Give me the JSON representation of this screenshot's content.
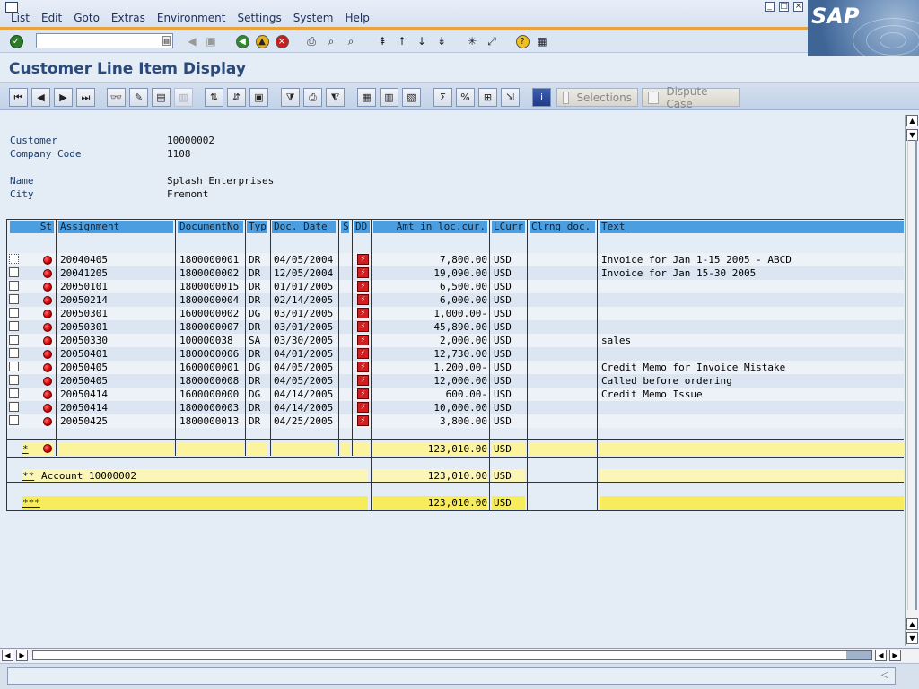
{
  "menubar": {
    "items": [
      "List",
      "Edit",
      "Goto",
      "Extras",
      "Environment",
      "Settings",
      "System",
      "Help"
    ],
    "logo": "SAP"
  },
  "systoolbar": {
    "command_value": ""
  },
  "title": "Customer Line Item Display",
  "apptoolbar": {
    "selections_label": "Selections",
    "dispute_label": "Dispute Case"
  },
  "header": {
    "customer_label": "Customer",
    "customer_value": "10000002",
    "company_code_label": "Company Code",
    "company_code_value": "1108",
    "name_label": "Name",
    "name_value": "Splash Enterprises",
    "city_label": "City",
    "city_value": "Fremont"
  },
  "grid": {
    "columns": [
      "St",
      "Assignment",
      "DocumentNo",
      "Typ",
      "Doc. Date",
      "S",
      "DD",
      "Amt in loc.cur.",
      "LCurr",
      "Clrng doc.",
      "Text"
    ],
    "rows": [
      {
        "assignment": "20040405",
        "docno": "1800000001",
        "typ": "DR",
        "date": "04/05/2004",
        "amount": "7,800.00",
        "curr": "USD",
        "text": "Invoice for Jan 1-15 2005 - ABCD"
      },
      {
        "assignment": "20041205",
        "docno": "1800000002",
        "typ": "DR",
        "date": "12/05/2004",
        "amount": "19,090.00",
        "curr": "USD",
        "text": "Invoice for Jan 15-30  2005"
      },
      {
        "assignment": "20050101",
        "docno": "1800000015",
        "typ": "DR",
        "date": "01/01/2005",
        "amount": "6,500.00",
        "curr": "USD",
        "text": ""
      },
      {
        "assignment": "20050214",
        "docno": "1800000004",
        "typ": "DR",
        "date": "02/14/2005",
        "amount": "6,000.00",
        "curr": "USD",
        "text": ""
      },
      {
        "assignment": "20050301",
        "docno": "1600000002",
        "typ": "DG",
        "date": "03/01/2005",
        "amount": "1,000.00-",
        "curr": "USD",
        "text": ""
      },
      {
        "assignment": "20050301",
        "docno": "1800000007",
        "typ": "DR",
        "date": "03/01/2005",
        "amount": "45,890.00",
        "curr": "USD",
        "text": ""
      },
      {
        "assignment": "20050330",
        "docno": "100000038",
        "typ": "SA",
        "date": "03/30/2005",
        "amount": "2,000.00",
        "curr": "USD",
        "text": "sales"
      },
      {
        "assignment": "20050401",
        "docno": "1800000006",
        "typ": "DR",
        "date": "04/01/2005",
        "amount": "12,730.00",
        "curr": "USD",
        "text": ""
      },
      {
        "assignment": "20050405",
        "docno": "1600000001",
        "typ": "DG",
        "date": "04/05/2005",
        "amount": "1,200.00-",
        "curr": "USD",
        "text": "Credit Memo for Invoice Mistake"
      },
      {
        "assignment": "20050405",
        "docno": "1800000008",
        "typ": "DR",
        "date": "04/05/2005",
        "amount": "12,000.00",
        "curr": "USD",
        "text": "Called before ordering"
      },
      {
        "assignment": "20050414",
        "docno": "1600000000",
        "typ": "DG",
        "date": "04/14/2005",
        "amount": "600.00-",
        "curr": "USD",
        "text": "Credit Memo Issue"
      },
      {
        "assignment": "20050414",
        "docno": "1800000003",
        "typ": "DR",
        "date": "04/14/2005",
        "amount": "10,000.00",
        "curr": "USD",
        "text": ""
      },
      {
        "assignment": "20050425",
        "docno": "1800000013",
        "typ": "DR",
        "date": "04/25/2005",
        "amount": "3,800.00",
        "curr": "USD",
        "text": ""
      }
    ],
    "subtotal": {
      "marker": "*",
      "amount": "123,010.00",
      "curr": "USD"
    },
    "account_total": {
      "marker": "**",
      "label": "Account 10000002",
      "amount": "123,010.00",
      "curr": "USD"
    },
    "grand_total": {
      "marker": "***",
      "amount": "123,010.00",
      "curr": "USD"
    }
  },
  "status": {
    "message": ""
  }
}
